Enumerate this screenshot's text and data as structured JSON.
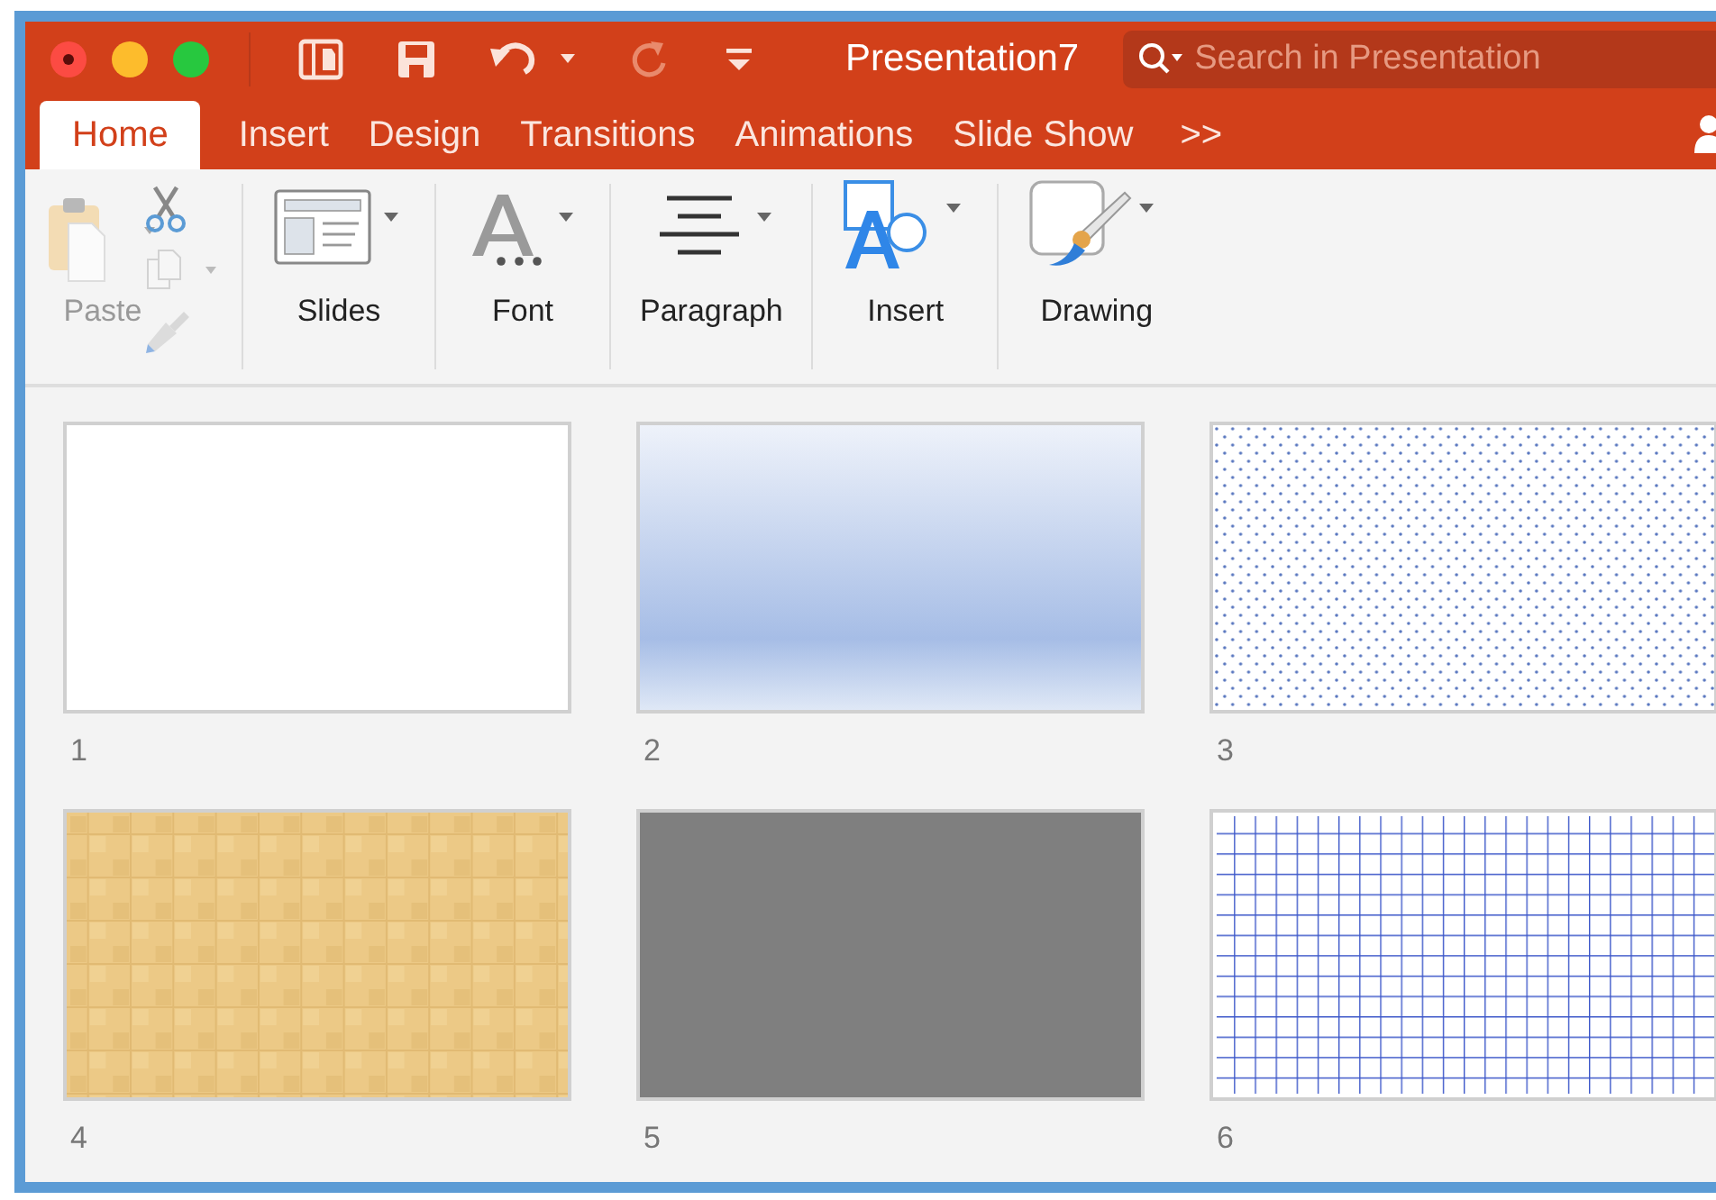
{
  "window": {
    "title": "Presentation7",
    "controls": [
      {
        "kind": "close",
        "color": "#fc4b43"
      },
      {
        "kind": "minimize",
        "color": "#fdbc2c"
      },
      {
        "kind": "zoom",
        "color": "#27c83f"
      }
    ]
  },
  "quick_access": [
    {
      "kind": "sidebar",
      "disabled": false
    },
    {
      "kind": "save",
      "disabled": false
    },
    {
      "kind": "undo",
      "disabled": false
    },
    {
      "kind": "redo",
      "disabled": true
    },
    {
      "kind": "customize",
      "disabled": false
    }
  ],
  "search": {
    "placeholder": "Search in Presentation"
  },
  "tabs": [
    {
      "label": "Home",
      "selected": true
    },
    {
      "label": "Insert",
      "selected": false
    },
    {
      "label": "Design",
      "selected": false
    },
    {
      "label": "Transitions",
      "selected": false
    },
    {
      "label": "Animations",
      "selected": false
    },
    {
      "label": "Slide Show",
      "selected": false
    }
  ],
  "tabs_overflow": ">>",
  "ribbon": [
    {
      "kind": "clipboard",
      "label": "Paste",
      "disabled": true
    },
    {
      "kind": "slides",
      "label": "Slides",
      "disabled": false
    },
    {
      "kind": "font",
      "label": "Font",
      "disabled": false
    },
    {
      "kind": "paragraph",
      "label": "Paragraph",
      "disabled": false
    },
    {
      "kind": "insert",
      "label": "Insert",
      "disabled": false
    },
    {
      "kind": "drawing",
      "label": "Drawing",
      "disabled": false
    }
  ],
  "slides": [
    {
      "number": "1",
      "kind": "blank"
    },
    {
      "number": "2",
      "kind": "gradient"
    },
    {
      "number": "3",
      "kind": "dots"
    },
    {
      "number": "4",
      "kind": "texture"
    },
    {
      "number": "5",
      "kind": "solid"
    },
    {
      "number": "6",
      "kind": "grid"
    }
  ]
}
